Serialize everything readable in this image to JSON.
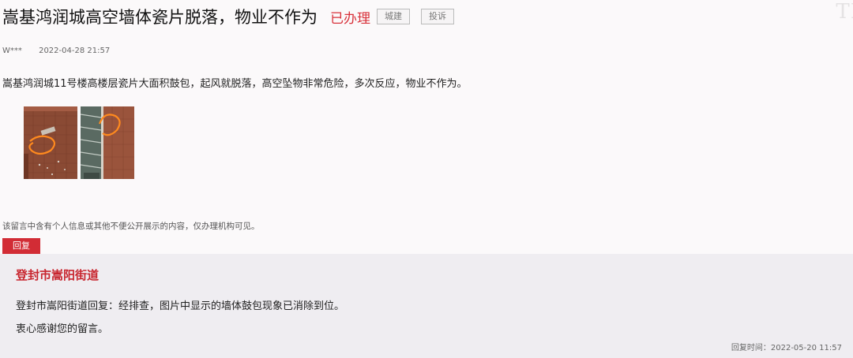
{
  "post": {
    "title": "嵩基鸿润城高空墙体瓷片脱落，物业不作为",
    "status": "已办理",
    "tags": [
      "城建",
      "投诉"
    ],
    "author": "W***",
    "datetime": "2022-04-28 21:57",
    "content": "嵩基鸿润城11号楼高楼层瓷片大面积鼓包，起风就脱落，高空坠物非常危险，多次反应，物业不作为。",
    "notice": "该留言中含有个人信息或其他不便公开展示的内容，仅办理机构可见。"
  },
  "watermark": "TI",
  "reply": {
    "badge": "回复",
    "org": "登封市嵩阳街道",
    "text1": "登封市嵩阳街道回复：经排查，图片中显示的墙体鼓包现象已消除到位。",
    "text2": "衷心感谢您的留言。",
    "time": "回复时间：2022-05-20 11:57"
  },
  "colors": {
    "accent_red": "#d22c35",
    "background": "#fbf9fa",
    "reply_bg": "#efedf1"
  }
}
